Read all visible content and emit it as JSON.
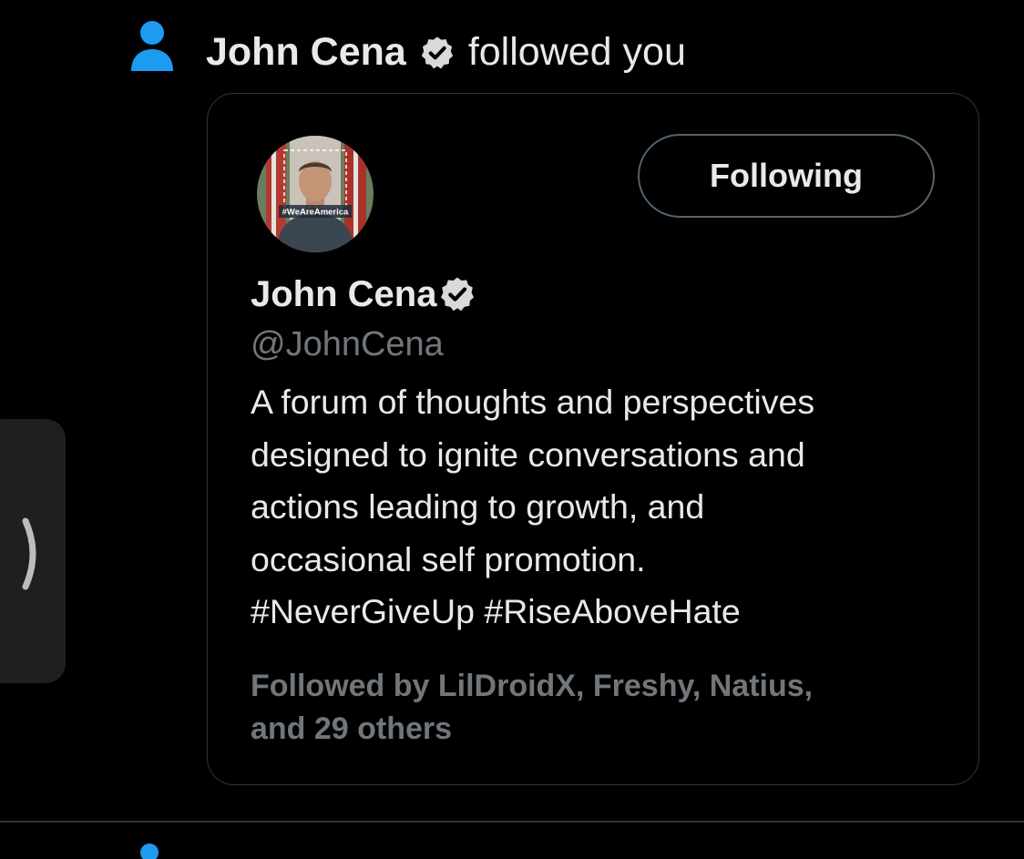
{
  "notification": {
    "icon": "person-icon",
    "name": "John Cena",
    "action": "followed you"
  },
  "profile_card": {
    "avatar_text": "#WeAreAmerica",
    "follow_button_label": "Following",
    "name": "John Cena",
    "handle": "@JohnCena",
    "bio_lines": [
      "A forum of thoughts and perspectives",
      "designed to ignite conversations and",
      "actions leading to growth, and",
      "occasional self promotion.",
      "#NeverGiveUp #RiseAboveHate"
    ],
    "followed_by_lines": [
      "Followed by LilDroidX, Freshy, Natius,",
      "and 29 others"
    ]
  },
  "colors": {
    "background": "#000000",
    "accent_blue": "#1d9bf0",
    "text_primary": "#e7e9ea",
    "text_secondary": "#71767b",
    "border": "#2f3336"
  }
}
